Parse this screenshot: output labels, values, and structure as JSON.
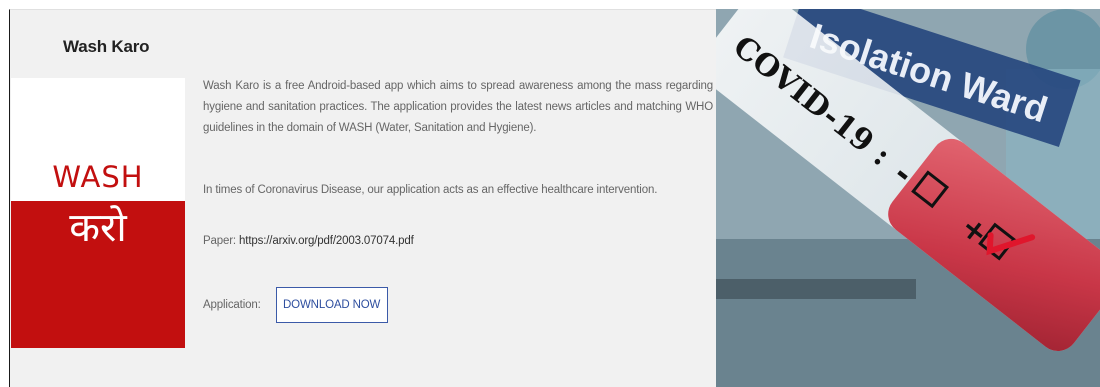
{
  "card": {
    "title": "Wash Karo",
    "logo": {
      "wash_text": "WASH",
      "karo_text": "करो"
    },
    "description": "Wash Karo is a free Android-based app which aims to spread awareness among the mass regarding hygiene and sanitation practices. The application provides the latest news articles and matching WHO guidelines in the domain of WASH (Water, Sanitation and Hygiene).",
    "intervention": "In times of Coronavirus Disease, our application acts as an effective healthcare intervention.",
    "paper_label": "Paper:",
    "paper_link": "https://arxiv.org/pdf/2003.07074.pdf",
    "application_label": "Application:",
    "download_button": "DOWNLOAD NOW"
  },
  "banner": {
    "sign_text": "Isolation Ward",
    "tube_text": "COVID-19 :",
    "negative_mark": "-",
    "positive_mark": "+"
  },
  "colors": {
    "logo_red": "#c20f0f",
    "button_blue": "#3b5aa8",
    "card_background": "#f1f1f1",
    "tube_red": "#d23a4a"
  }
}
